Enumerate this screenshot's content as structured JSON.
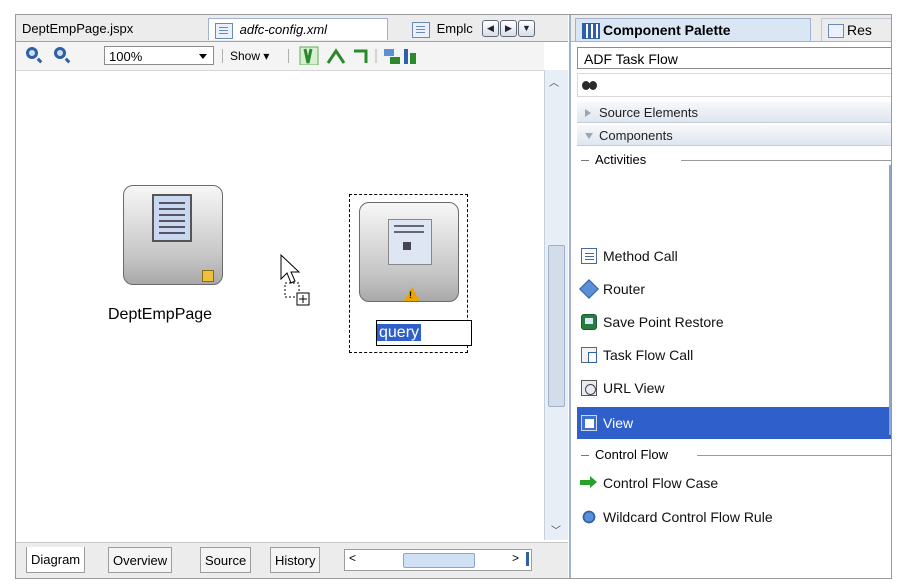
{
  "editor": {
    "tabs": [
      {
        "label": "DeptEmpPage.jspx",
        "active": false
      },
      {
        "label": "adfc-config.xml",
        "active": true
      },
      {
        "label": "Emplc",
        "active": false
      }
    ],
    "toolbar": {
      "zoom_value": "100%",
      "show_label": "Show ▾"
    },
    "canvas": {
      "nodes": [
        {
          "label": "DeptEmpPage",
          "type": "view"
        },
        {
          "label": "query",
          "type": "view",
          "editing": true,
          "warning": true
        }
      ]
    },
    "bottom_tabs": [
      "Diagram",
      "Overview",
      "Source",
      "History"
    ],
    "active_bottom_tab": "Diagram"
  },
  "palette": {
    "tabs": [
      {
        "label": "Component Palette",
        "active": true
      },
      {
        "label": "Res",
        "active": false
      }
    ],
    "library": "ADF Task Flow",
    "sections": {
      "source_elements": "Source Elements",
      "components": "Components"
    },
    "groups": {
      "activities": "Activities",
      "control_flow": "Control Flow"
    },
    "activities": [
      {
        "label": "Method Call",
        "icon": "method-call-icon"
      },
      {
        "label": "Router",
        "icon": "router-icon"
      },
      {
        "label": "Save Point Restore",
        "icon": "save-point-icon"
      },
      {
        "label": "Task Flow Call",
        "icon": "task-flow-call-icon"
      },
      {
        "label": "URL View",
        "icon": "url-view-icon"
      },
      {
        "label": "View",
        "icon": "view-icon",
        "selected": true
      }
    ],
    "control_flow": [
      {
        "label": "Control Flow Case",
        "icon": "arrow-right-icon"
      },
      {
        "label": "Wildcard Control Flow Rule",
        "icon": "wildcard-icon"
      }
    ]
  },
  "colors": {
    "selection": "#2e5fcb",
    "accent": "#2e5fa8",
    "warning": "#e8a500"
  }
}
